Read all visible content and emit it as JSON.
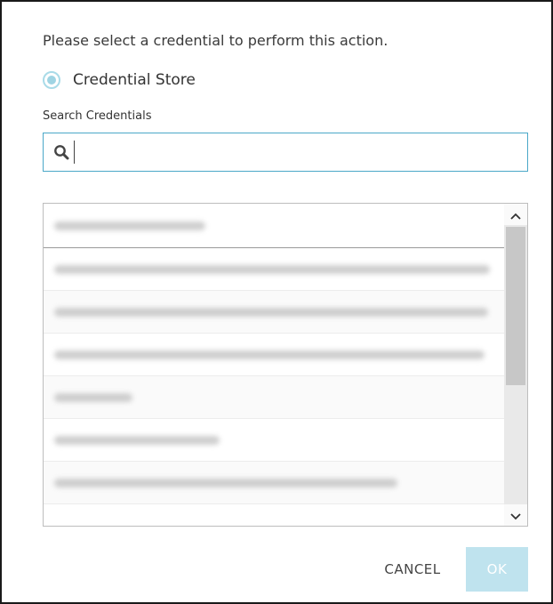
{
  "dialog": {
    "prompt": "Please select a credential to perform this action.",
    "radio_label": "Credential Store",
    "radio_selected": true,
    "search_label": "Search Credentials",
    "search_value": "",
    "buttons": {
      "cancel": "CANCEL",
      "ok": "OK"
    },
    "colors": {
      "accent": "#4aa8c8",
      "ok_disabled": "#bfe3ee",
      "radio": "#9fd4e3"
    }
  },
  "icons": {
    "search": "search-icon",
    "scroll_up": "chevron-up-icon",
    "scroll_down": "chevron-down-icon"
  }
}
